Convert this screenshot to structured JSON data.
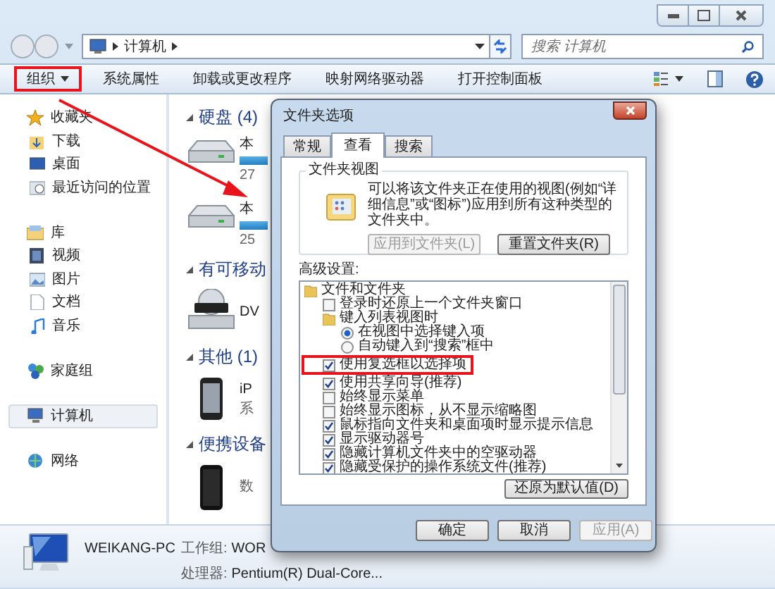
{
  "address_bar": {
    "path": [
      "计算机"
    ]
  },
  "search": {
    "placeholder": "搜索 计算机"
  },
  "toolbar": [
    {
      "label": "组织",
      "kind": "menu",
      "highlighted": true
    },
    {
      "label": "系统属性",
      "kind": "button"
    },
    {
      "label": "卸载或更改程序",
      "kind": "button"
    },
    {
      "label": "映射网络驱动器",
      "kind": "button"
    },
    {
      "label": "打开控制面板",
      "kind": "button"
    }
  ],
  "navigation": [
    {
      "label": "收藏夹",
      "selected": false,
      "children": [
        {
          "label": "下载",
          "selected": false
        },
        {
          "label": "桌面",
          "selected": false
        },
        {
          "label": "最近访问的位置",
          "selected": false
        }
      ]
    },
    {
      "label": "库",
      "selected": false,
      "children": [
        {
          "label": "视频",
          "selected": false
        },
        {
          "label": "图片",
          "selected": false
        },
        {
          "label": "文档",
          "selected": false
        },
        {
          "label": "音乐",
          "selected": false
        }
      ]
    },
    {
      "label": "家庭组",
      "selected": false
    },
    {
      "label": "计算机",
      "selected": true
    },
    {
      "label": "网络",
      "selected": false
    }
  ],
  "content": [
    {
      "header": "硬盘 (4)",
      "items": [
        {
          "kind": "drive",
          "name": "本",
          "size": "27"
        },
        {
          "kind": "drive",
          "name": "本",
          "size": "25"
        }
      ]
    },
    {
      "header": "有可移动",
      "items": [
        {
          "kind": "dvd",
          "name": "DV"
        }
      ]
    },
    {
      "header": "其他 (1)",
      "items": [
        {
          "kind": "phone",
          "name": "iP",
          "size": "系"
        }
      ]
    },
    {
      "header": "便携设备",
      "items": [
        {
          "kind": "device",
          "size": "数"
        }
      ]
    }
  ],
  "details": {
    "name": "WEIKANG-PC",
    "fields": [
      {
        "label": "工作组:",
        "value": "WOR"
      },
      {
        "label": "处理器:",
        "value": "Pentium(R) Dual-Core..."
      }
    ]
  },
  "dialog": {
    "title": "文件夹选项",
    "tabs": [
      {
        "label": "常规",
        "selected": false
      },
      {
        "label": "查看",
        "selected": true
      },
      {
        "label": "搜索",
        "selected": false
      }
    ],
    "folder_views": {
      "legend": "文件夹视图",
      "text": "可以将该文件夹正在使用的视图(例如“详细信息”或“图标”)应用到所有这种类型的文件夹中。",
      "buttons": [
        {
          "label": "应用到文件夹(L)",
          "disabled": true
        },
        {
          "label": "重置文件夹(R)",
          "disabled": false
        }
      ]
    },
    "advanced_label": "高级设置:",
    "advanced": [
      {
        "kind": "folder",
        "label": "文件和文件夹",
        "children": [
          {
            "kind": "checkbox",
            "label": "登录时还原上一个文件夹窗口",
            "checked": false
          },
          {
            "kind": "folder",
            "label": "键入列表视图时",
            "children": [
              {
                "kind": "radio",
                "label": "在视图中选择键入项",
                "selected": true
              },
              {
                "kind": "radio",
                "label": "自动键入到“搜索”框中",
                "selected": false
              }
            ]
          },
          {
            "kind": "checkbox",
            "label": "使用复选框以选择项",
            "checked": true,
            "highlighted": true
          },
          {
            "kind": "checkbox",
            "label": "使用共享向导(推荐)",
            "checked": true
          },
          {
            "kind": "checkbox",
            "label": "始终显示菜单",
            "checked": false
          },
          {
            "kind": "checkbox",
            "label": "始终显示图标，从不显示缩略图",
            "checked": false
          },
          {
            "kind": "checkbox",
            "label": "鼠标指向文件夹和桌面项时显示提示信息",
            "checked": true
          },
          {
            "kind": "checkbox",
            "label": "显示驱动器号",
            "checked": true
          },
          {
            "kind": "checkbox",
            "label": "隐藏计算机文件夹中的空驱动器",
            "checked": true
          },
          {
            "kind": "checkbox",
            "label": "隐藏受保护的操作系统文件(推荐)",
            "checked": true
          }
        ]
      }
    ],
    "restore_button": {
      "label": "还原为默认值(D)",
      "disabled": false
    },
    "buttons": [
      {
        "label": "确定",
        "disabled": false
      },
      {
        "label": "取消",
        "disabled": false
      },
      {
        "label": "应用(A)",
        "disabled": true
      }
    ]
  }
}
